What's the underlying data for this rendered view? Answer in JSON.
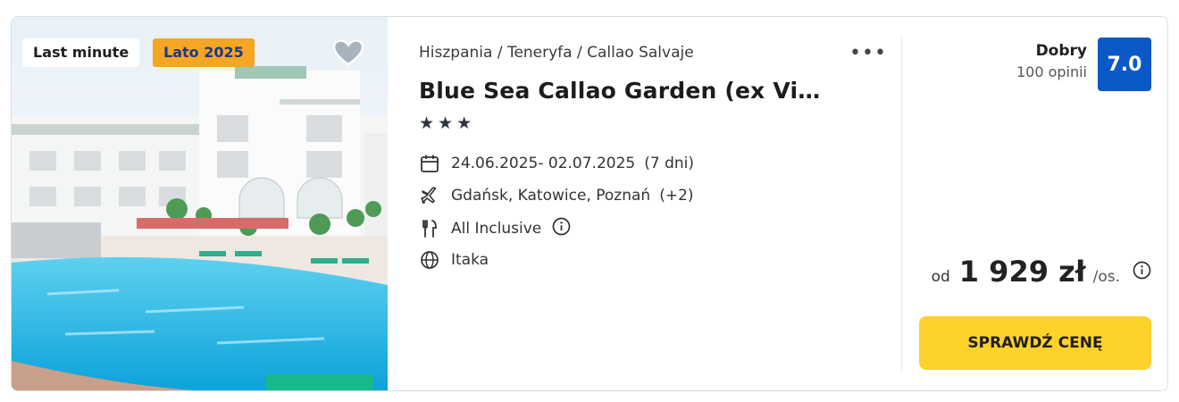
{
  "badges": {
    "last_minute": "Last minute",
    "season": "Lato 2025"
  },
  "breadcrumb": "Hiszpania / Teneryfa / Callao Salvaje",
  "hotel": {
    "name": "Blue Sea Callao Garden (ex Vi…",
    "stars": 3
  },
  "details": {
    "dates": "24.06.2025- 02.07.2025",
    "duration": "(7 dni)",
    "departures": "Gdańsk, Katowice, Poznań",
    "departures_more": "(+2)",
    "board": "All Inclusive",
    "operator": "Itaka"
  },
  "rating": {
    "label": "Dobry",
    "reviews": "100 opinii",
    "score": "7.0"
  },
  "price": {
    "prefix": "od",
    "amount": "1 929 zł",
    "suffix": "/os."
  },
  "cta": {
    "label": "SPRAWDŹ CENĘ"
  },
  "colors": {
    "rating_bg": "#0b58c7",
    "cta_bg": "#fdd22b",
    "season_badge": "#f5a623"
  },
  "icons": [
    "heart-icon",
    "more-dots-icon",
    "calendar-icon",
    "plane-icon",
    "cutlery-icon",
    "info-icon",
    "globe-icon"
  ]
}
